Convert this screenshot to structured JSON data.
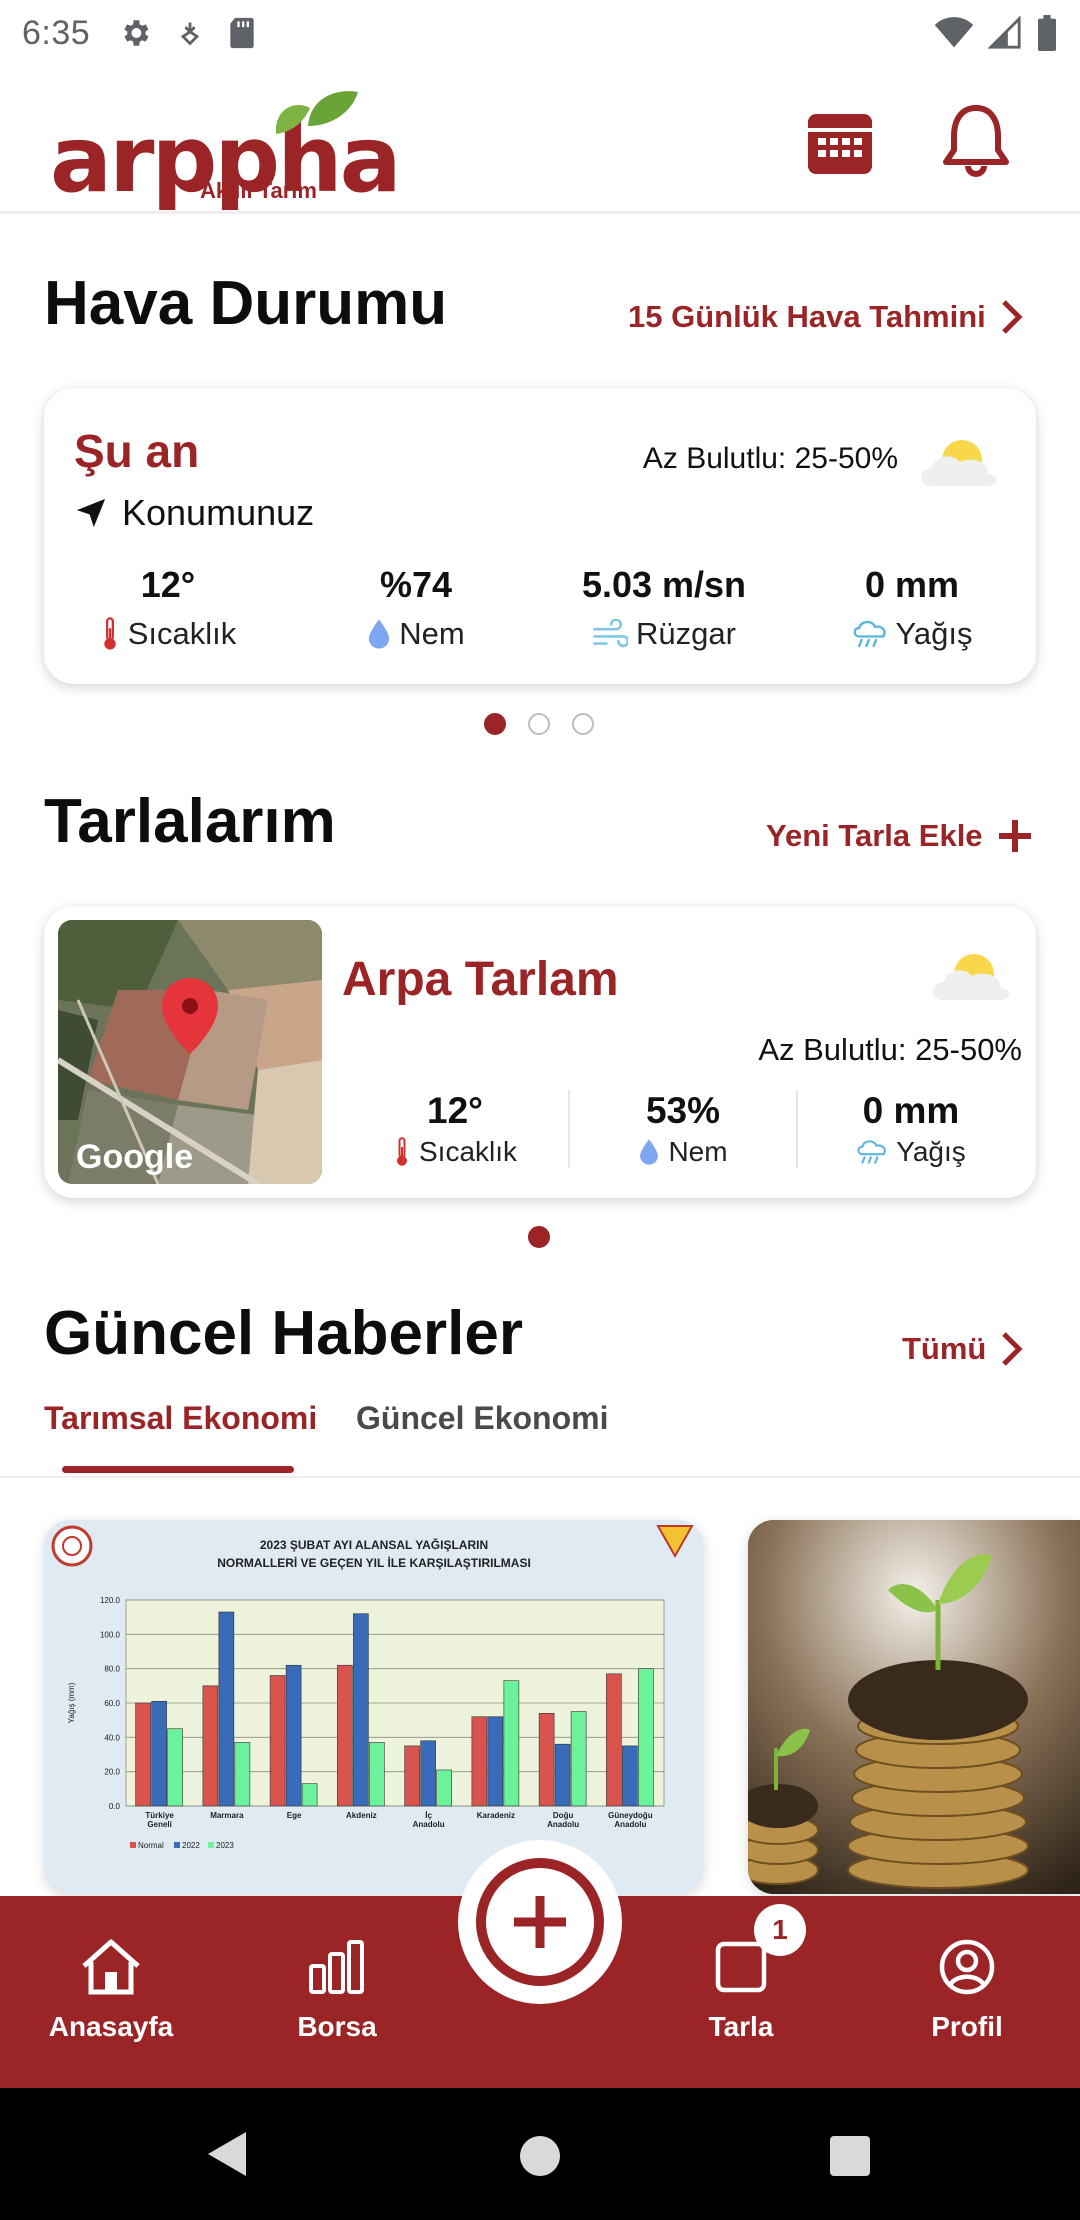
{
  "status_bar": {
    "time": "6:35"
  },
  "app": {
    "logo_text": "arppha",
    "logo_subtitle": "Akıllı Tarım",
    "brand_color": "#9b2427"
  },
  "weather": {
    "title": "Hava Durumu",
    "forecast_link": "15 Günlük Hava Tahmini",
    "card": {
      "now_label": "Şu an",
      "location": "Konumunuz",
      "condition": "Az Bulutlu: 25-50%",
      "stats": [
        {
          "value": "12°",
          "label": "Sıcaklık",
          "icon": "thermometer-icon"
        },
        {
          "value": "%74",
          "label": "Nem",
          "icon": "droplet-icon"
        },
        {
          "value": "5.03 m/sn",
          "label": "Rüzgar",
          "icon": "wind-icon"
        },
        {
          "value": "0 mm",
          "label": "Yağış",
          "icon": "rain-cloud-icon"
        }
      ]
    }
  },
  "fields": {
    "title": "Tarlalarım",
    "add_link": "Yeni Tarla Ekle",
    "card": {
      "name": "Arpa Tarlam",
      "condition": "Az Bulutlu: 25-50%",
      "map_attribution": "Google",
      "stats": [
        {
          "value": "12°",
          "label": "Sıcaklık",
          "icon": "thermometer-icon"
        },
        {
          "value": "53%",
          "label": "Nem",
          "icon": "droplet-icon"
        },
        {
          "value": "0 mm",
          "label": "Yağış",
          "icon": "rain-cloud-icon"
        }
      ]
    }
  },
  "news": {
    "title": "Güncel Haberler",
    "all_link": "Tümü",
    "tabs": [
      "Tarımsal Ekonomi",
      "Güncel Ekonomi"
    ],
    "active_tab": "Tarımsal Ekonomi",
    "cards": [
      {
        "chart_title_1": "2023 ŞUBAT AYI ALANSAL YAĞIŞLARIN",
        "chart_title_2": "NORMALLERİ VE GEÇEN YIL İLE KARŞILAŞTIRILMASI",
        "ylabel": "Yağış (mm)",
        "legend": [
          "Normal",
          "2022",
          "2023"
        ],
        "chart_data": {
          "type": "bar",
          "categories": [
            "Türkiye Geneli",
            "Marmara",
            "Ege",
            "Akdeniz",
            "İç Anadolu",
            "Karadeniz",
            "Doğu Anadolu",
            "Güneydoğu Anadolu"
          ],
          "series": [
            {
              "name": "Normal",
              "values": [
                60,
                70,
                76,
                82,
                35,
                52,
                54,
                77
              ]
            },
            {
              "name": "2022",
              "values": [
                61,
                113,
                82,
                112,
                38,
                52,
                36,
                35
              ]
            },
            {
              "name": "2023",
              "values": [
                45,
                37,
                13,
                37,
                21,
                73,
                55,
                80
              ]
            }
          ],
          "ylim": [
            0,
            120
          ],
          "yticks": [
            "0.0",
            "20.0",
            "40.0",
            "60.0",
            "80.0",
            "100.0",
            "120.0"
          ]
        }
      }
    ]
  },
  "bottom_nav": {
    "items": [
      {
        "label": "Anasayfa",
        "icon": "home-icon"
      },
      {
        "label": "Borsa",
        "icon": "bar-chart-icon"
      },
      {
        "label": "Tarla",
        "icon": "square-icon"
      },
      {
        "label": "Profil",
        "icon": "profile-icon"
      }
    ],
    "tarla_badge": "1",
    "fab_icon": "plus-icon"
  }
}
